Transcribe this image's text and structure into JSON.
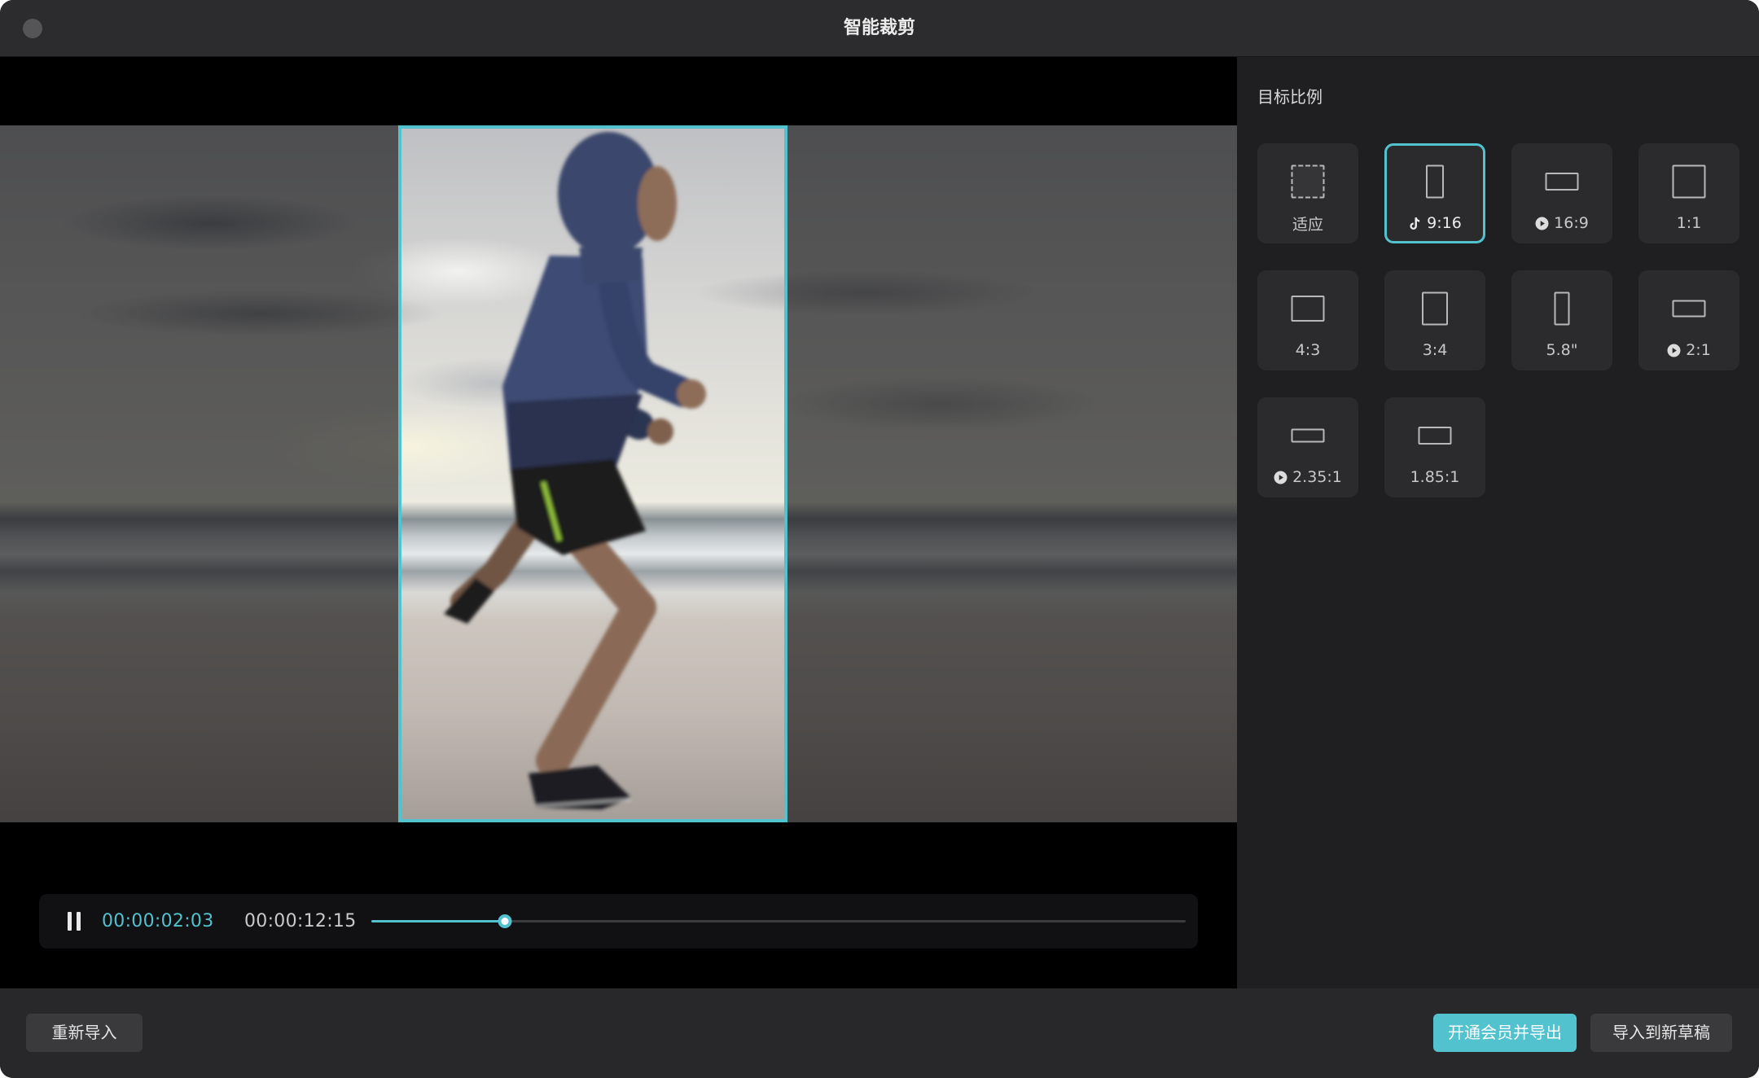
{
  "window": {
    "title": "智能裁剪",
    "close_icon": "window-close-dot-icon"
  },
  "panel": {
    "heading": "目标比例",
    "selected_index": 1,
    "ratios": [
      {
        "label": "适应",
        "icon": "fit-dashed-frame-icon",
        "badge_icon": null
      },
      {
        "label": "9:16",
        "icon": "portrait-9-16-icon",
        "badge_icon": "tiktok-icon"
      },
      {
        "label": "16:9",
        "icon": "landscape-16-9-icon",
        "badge_icon": "play-badge-icon"
      },
      {
        "label": "1:1",
        "icon": "square-1-1-icon",
        "badge_icon": null
      },
      {
        "label": "4:3",
        "icon": "landscape-4-3-icon",
        "badge_icon": null
      },
      {
        "label": "3:4",
        "icon": "portrait-3-4-icon",
        "badge_icon": null
      },
      {
        "label": "5.8\"",
        "icon": "phone-5-8-icon",
        "badge_icon": null
      },
      {
        "label": "2:1",
        "icon": "wide-2-1-icon",
        "badge_icon": "play-badge-icon"
      },
      {
        "label": "2.35:1",
        "icon": "cinema-2-35-1-icon",
        "badge_icon": "play-badge-icon"
      },
      {
        "label": "1.85:1",
        "icon": "cinema-1-85-1-icon",
        "badge_icon": null
      }
    ]
  },
  "player": {
    "control_icon": "pause-icon",
    "current_time": "00:00:02:03",
    "duration": "00:00:12:15",
    "progress": 0.164
  },
  "footer": {
    "reimport_label": "重新导入",
    "vip_export_label": "开通会员并导出",
    "import_draft_label": "导入到新草稿"
  },
  "colors": {
    "accent": "#52c2cf",
    "tile_bg": "#2b2b2d",
    "panel_bg": "#1f1f21"
  }
}
